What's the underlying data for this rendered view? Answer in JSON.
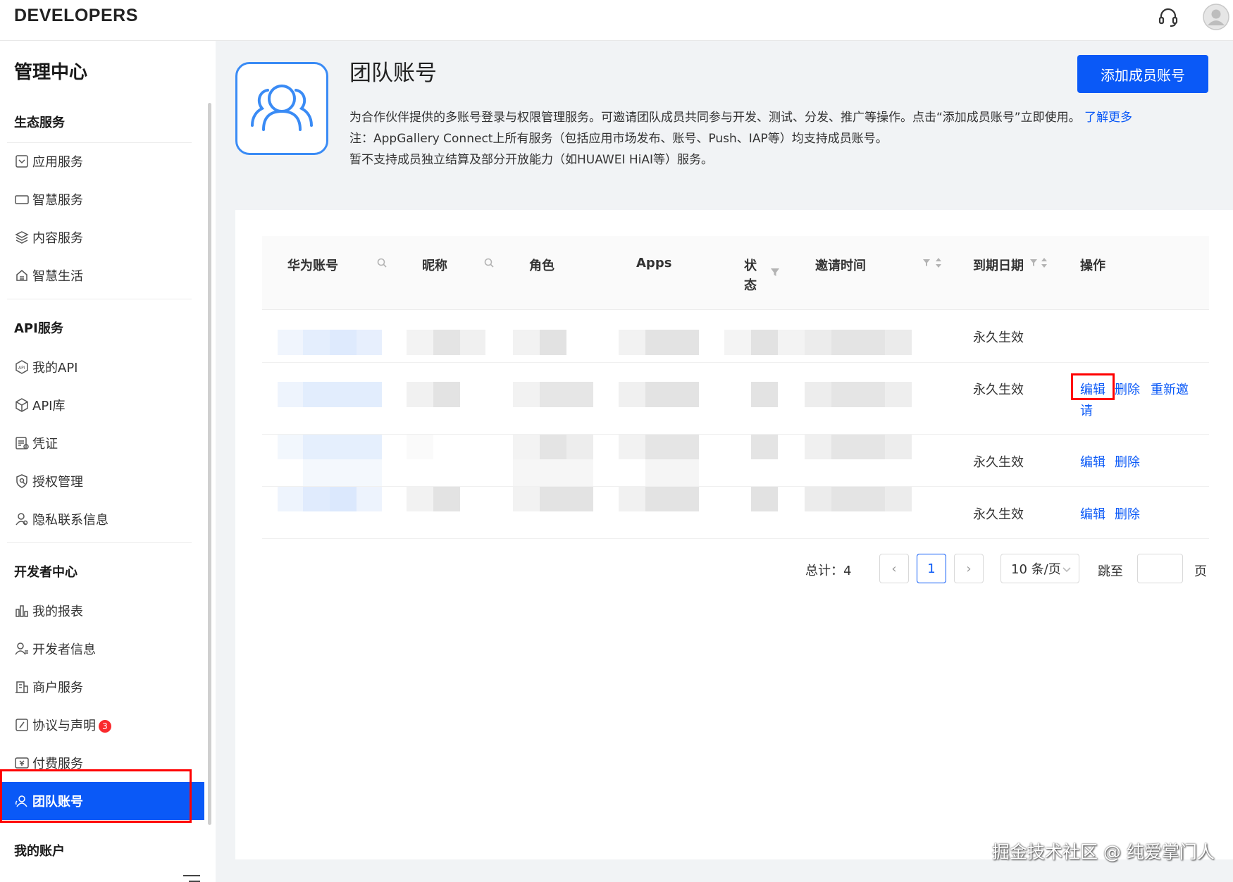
{
  "header": {
    "brand": "DEVELOPERS",
    "support_icon": "headset-icon",
    "user_icon": "avatar-icon"
  },
  "sidebar": {
    "title": "管理中心",
    "groups": [
      {
        "heading": "生态服务",
        "items": [
          {
            "label": "应用服务",
            "icon": "app-service-icon"
          },
          {
            "label": "智慧服务",
            "icon": "smart-service-icon"
          },
          {
            "label": "内容服务",
            "icon": "layers-icon"
          },
          {
            "label": "智慧生活",
            "icon": "smart-life-icon"
          }
        ]
      },
      {
        "heading": "API服务",
        "items": [
          {
            "label": "我的API",
            "icon": "api-icon"
          },
          {
            "label": "API库",
            "icon": "cube-icon"
          },
          {
            "label": "凭证",
            "icon": "credential-icon"
          },
          {
            "label": "授权管理",
            "icon": "shield-icon"
          },
          {
            "label": "隐私联系信息",
            "icon": "privacy-contact-icon"
          }
        ]
      },
      {
        "heading": "开发者中心",
        "items": [
          {
            "label": "我的报表",
            "icon": "bar-chart-icon"
          },
          {
            "label": "开发者信息",
            "icon": "developer-info-icon"
          },
          {
            "label": "商户服务",
            "icon": "merchant-icon"
          },
          {
            "label": "协议与声明",
            "icon": "agreement-icon",
            "badge": "3"
          },
          {
            "label": "付费服务",
            "icon": "paid-service-icon"
          },
          {
            "label": "团队账号",
            "icon": "team-icon",
            "active": true
          }
        ]
      },
      {
        "heading": "我的账户",
        "items": []
      }
    ]
  },
  "main": {
    "title": "团队账号",
    "add_button": "添加成员账号",
    "desc_line1": "为合作伙伴提供的多账号登录与权限管理服务。可邀请团队成员共同参与开发、测试、分发、推广等操作。点击“添加成员账号”立即使用。",
    "learn_more": "了解更多",
    "desc_line2": "注：AppGallery Connect上所有服务（包括应用市场发布、账号、Push、IAP等）均支持成员账号。",
    "desc_line3": "暂不支持成员独立结算及部分开放能力（如HUAWEI HiAI等）服务。"
  },
  "table": {
    "columns": {
      "huawei_account": "华为账号",
      "nickname": "昵称",
      "role": "角色",
      "apps": "Apps",
      "status_1": "状",
      "status_2": "态",
      "invite_time": "邀请时间",
      "expiry_date": "到期日期",
      "actions": "操作"
    },
    "rows": [
      {
        "expiry": "永久生效",
        "actions": []
      },
      {
        "expiry": "永久生效",
        "actions": [
          "编辑",
          "删除",
          "重新邀",
          "请"
        ]
      },
      {
        "expiry": "永久生效",
        "actions": [
          "编辑",
          "删除"
        ]
      },
      {
        "expiry": "永久生效",
        "actions": [
          "编辑",
          "删除"
        ]
      }
    ]
  },
  "pagination": {
    "total": "总计：4",
    "prev": "‹",
    "current_page": "1",
    "next": "›",
    "page_size": "10 条/页",
    "goto_label": "跳至",
    "page_label": "页",
    "goto_value": ""
  },
  "watermark": "掘金技术社区 @ 纯爱掌门人"
}
